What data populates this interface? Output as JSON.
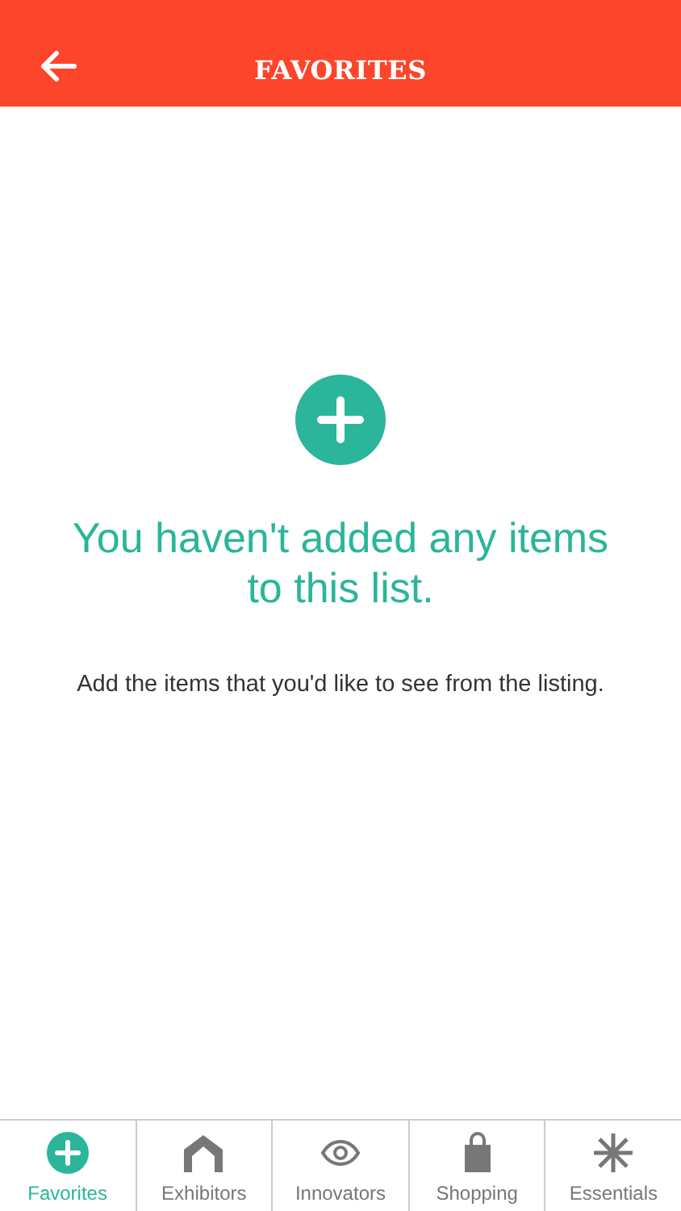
{
  "header": {
    "title": "FAVORITES"
  },
  "empty_state": {
    "headline": "You haven't added any items to this list.",
    "message": "Add the items that you'd like to see from the listing."
  },
  "tabs": [
    {
      "label": "Favorites",
      "kind": "plus",
      "selected": true
    },
    {
      "label": "Exhibitors",
      "kind": "house",
      "selected": false
    },
    {
      "label": "Innovators",
      "kind": "eye",
      "selected": false
    },
    {
      "label": "Shopping",
      "kind": "bag",
      "selected": false
    },
    {
      "label": "Essentials",
      "kind": "asterisk",
      "selected": false
    }
  ]
}
